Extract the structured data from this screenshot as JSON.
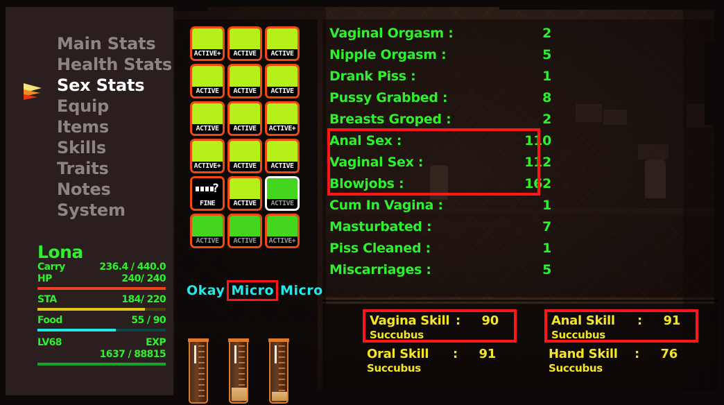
{
  "sidebar": {
    "menu_items": [
      {
        "label": "Main Stats",
        "selected": false
      },
      {
        "label": "Health Stats",
        "selected": false
      },
      {
        "label": "Sex Stats",
        "selected": true
      },
      {
        "label": "Equip",
        "selected": false
      },
      {
        "label": "Items",
        "selected": false
      },
      {
        "label": "Skills",
        "selected": false
      },
      {
        "label": "Traits",
        "selected": false
      },
      {
        "label": "Notes",
        "selected": false
      },
      {
        "label": "System",
        "selected": false
      }
    ],
    "cursor_icon": "arrow-cursor-icon",
    "character": {
      "name": "Lona",
      "rows": [
        {
          "label": "Carry",
          "value": "236.4 / 440.0",
          "bar": null
        },
        {
          "label": "HP",
          "value": "240/ 240",
          "bar": {
            "name": "hp",
            "percent": 100,
            "color": "#f0401a"
          }
        },
        {
          "label": "STA",
          "value": "184/ 220",
          "bar": {
            "name": "sta",
            "percent": 84,
            "color": "#e2c41a"
          }
        },
        {
          "label": "Food",
          "value": "55 / 90",
          "bar": {
            "name": "food",
            "percent": 61,
            "color": "#22e8e8"
          }
        }
      ],
      "level_label": "LV68",
      "exp_label": "EXP",
      "exp_value": "1637 / 88815",
      "exp_percent": 100,
      "exp_color": "#17a62c"
    }
  },
  "body_grid": {
    "cells": [
      {
        "tag": "ACTIVE+",
        "state": "lit",
        "focused": false
      },
      {
        "tag": "ACTIVE",
        "state": "lit",
        "focused": false
      },
      {
        "tag": "ACTIVE",
        "state": "lit",
        "focused": false
      },
      {
        "tag": "ACTIVE",
        "state": "lit",
        "focused": false
      },
      {
        "tag": "ACTIVE",
        "state": "lit",
        "focused": false
      },
      {
        "tag": "ACTIVE",
        "state": "lit",
        "focused": false
      },
      {
        "tag": "ACTIVE",
        "state": "lit",
        "focused": false
      },
      {
        "tag": "ACTIVE",
        "state": "lit",
        "focused": false
      },
      {
        "tag": "ACTIVE+",
        "state": "lit",
        "focused": false
      },
      {
        "tag": "ACTIVE+",
        "state": "lit",
        "focused": false
      },
      {
        "tag": "ACTIVE",
        "state": "lit",
        "focused": false
      },
      {
        "tag": "ACTIVE",
        "state": "lit",
        "focused": false
      },
      {
        "tag": "FINE",
        "state": "question",
        "focused": false,
        "icon": "question-mark-icon"
      },
      {
        "tag": "ACTIVE",
        "state": "lit",
        "focused": false
      },
      {
        "tag": "ACTIVE",
        "state": "dim",
        "focused": true
      },
      {
        "tag": "ACTIVE",
        "state": "dim",
        "focused": false
      },
      {
        "tag": "ACTIVE",
        "state": "dim",
        "focused": false
      },
      {
        "tag": "ACTIVE+",
        "state": "dim",
        "focused": false
      }
    ],
    "size_labels": [
      {
        "label": "Okay",
        "highlighted": false
      },
      {
        "label": "Micro",
        "highlighted": true
      },
      {
        "label": "Micro",
        "highlighted": false
      }
    ],
    "vials": [
      {
        "name": "vial-empty",
        "fill_percent": 0
      },
      {
        "name": "vial-part-full",
        "fill_percent": 22
      },
      {
        "name": "vial-part-full",
        "fill_percent": 15
      }
    ]
  },
  "sex_stats": {
    "rows": [
      {
        "label": "Vaginal Orgasm :",
        "value": "2",
        "highlighted": false
      },
      {
        "label": "Nipple Orgasm :",
        "value": "5",
        "highlighted": false
      },
      {
        "label": "Drank Piss :",
        "value": "1",
        "highlighted": false
      },
      {
        "label": "Pussy Grabbed :",
        "value": "8",
        "highlighted": false
      },
      {
        "label": "Breasts Groped :",
        "value": "2",
        "highlighted": false
      },
      {
        "label": "Anal Sex :",
        "value": "110",
        "highlighted": true
      },
      {
        "label": "Vaginal Sex :",
        "value": "112",
        "highlighted": true
      },
      {
        "label": "Blowjobs :",
        "value": "162",
        "highlighted": true
      },
      {
        "label": "Cum In Vagina :",
        "value": "1",
        "highlighted": false
      },
      {
        "label": "Masturbated :",
        "value": "7",
        "highlighted": false
      },
      {
        "label": "Piss Cleaned :",
        "value": "1",
        "highlighted": false
      },
      {
        "label": "Miscarriages :",
        "value": "5",
        "highlighted": false
      }
    ]
  },
  "skills": {
    "cells": [
      {
        "name": "Vagina Skill",
        "colon": ":",
        "value": "90",
        "rank": "Succubus",
        "highlighted": true
      },
      {
        "name": "Anal Skill",
        "colon": ":",
        "value": "91",
        "rank": "Succubus",
        "highlighted": true
      },
      {
        "name": "Oral Skill",
        "colon": ":",
        "value": "91",
        "rank": "Succubus",
        "highlighted": false
      },
      {
        "name": "Hand Skill",
        "colon": ":",
        "value": "76",
        "rank": "Succubus",
        "highlighted": false
      }
    ]
  },
  "colors": {
    "highlight_red": "#ff1616",
    "stat_green": "#2ef02e",
    "skill_yellow": "#f2e528",
    "label_cyan": "#22e8e8",
    "cell_orange": "#f04a14",
    "cell_lit": "#b5f01a",
    "cell_dim": "#44d51e",
    "menu_inactive": "#8c8683",
    "menu_active": "#ffffff"
  }
}
